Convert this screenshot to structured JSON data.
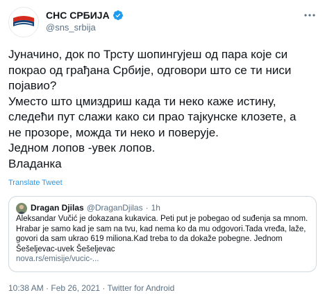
{
  "author": {
    "name": "СНС СРБИЈА",
    "handle": "@sns_srbija",
    "verified": true,
    "avatar_icon": "sns-logo-icon"
  },
  "tweet": {
    "lines": [
      "Јуначино, док по Трсту шопингујеш од пара које си",
      "покрао од грађана Србије, одговори што се ти ниси",
      "појавио?",
      "Уместо што цмиздриш када ти неко каже истину,",
      "следећи пут слажи како си прао тајкунске клозете, а",
      "не прозоре, можда ти неко и поверује.",
      "Једном лопов -увек лопов.",
      "Владанка"
    ],
    "translate_label": "Translate Tweet"
  },
  "quoted": {
    "name": "Dragan Djilas",
    "handle": "@DraganDjilas",
    "dot": "·",
    "time": "1h",
    "lines": [
      "Aleksandar Vučić je dokazana kukavica. Peti put je pobegao od suđenja sa mnom.",
      "Hrabar je samo kad je sam na tvu, kad nema ko da mu odgovori.Tada vređa, laže,",
      "govori da sam ukrao 619 miliona.Kad treba to da dokaže pobegne. Jednom",
      "Šešeljevac-uvek Šešeljevac"
    ],
    "link": "nova.rs/emisije/vucic-..."
  },
  "meta": {
    "text": "10:38 AM · Feb 26, 2021 · Twitter for Android"
  },
  "colors": {
    "accent": "#1d9bf0",
    "secondary_text": "#5b7083",
    "border": "#cfd9de",
    "logo_red": "#d52b1e",
    "logo_blue": "#0c4076"
  }
}
